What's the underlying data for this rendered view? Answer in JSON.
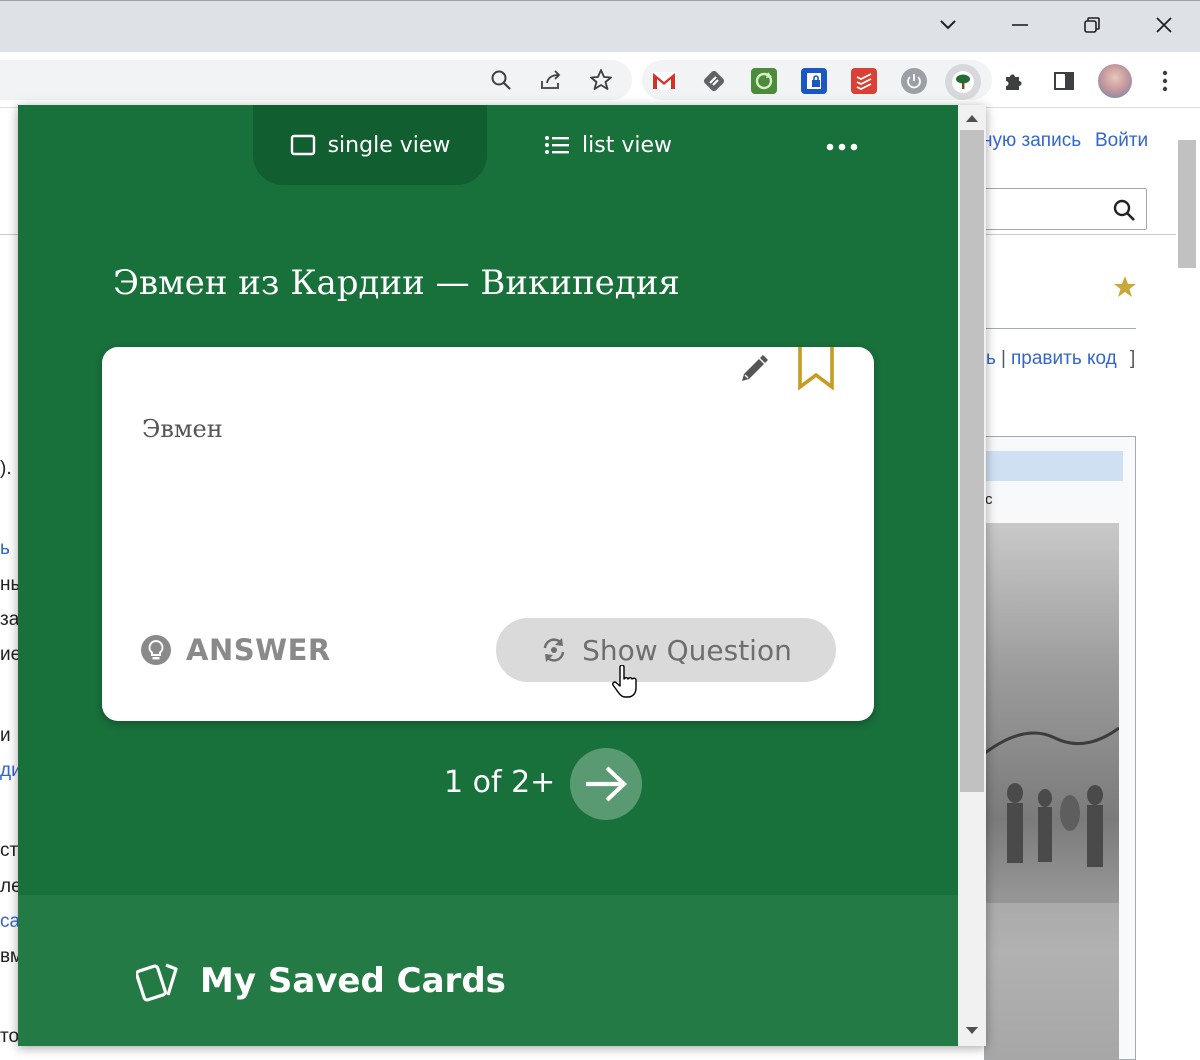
{
  "browser": {
    "window_controls": {
      "tab_search": "chevron-down-icon",
      "minimize": "minimize-icon",
      "restore": "restore-icon",
      "close": "close-icon"
    },
    "toolbar_icons": [
      "search-icon",
      "share-icon",
      "star-icon"
    ],
    "extensions": [
      "gmail-icon",
      "feedly-icon",
      "refresh-extension-icon",
      "lock-extension-icon",
      "todoist-icon",
      "power-icon",
      "tree-extension-icon",
      "puzzle-icon",
      "side-panel-icon",
      "profile-avatar",
      "kebab-menu-icon"
    ]
  },
  "wiki": {
    "create_account": "ную запись",
    "login": "Войти",
    "edit_links": {
      "edit_prefix": "ь",
      "separator": "|",
      "edit_code": "править код",
      "close_bracket": "]"
    },
    "left_fragments": [
      "). Г",
      "ь",
      "ны",
      "за",
      "ие",
      "и",
      "ди",
      "ст",
      "ле",
      "са",
      "вм",
      "то"
    ],
    "infobox_fragment": "с"
  },
  "popup": {
    "tabs": {
      "single_view": "single view",
      "list_view": "list view"
    },
    "title": "Эвмен из Кардии — Википедия",
    "card": {
      "text": "Эвмен",
      "answer_label": "ANSWER",
      "show_question": "Show Question"
    },
    "counter": "1 of 2+",
    "footer": {
      "saved_cards": "My Saved Cards"
    },
    "colors": {
      "main_bg": "#18703b",
      "active_tab_bg": "#115e30",
      "footer_bg": "#247a45",
      "bookmark": "#c89b22",
      "next_button": "#5a9a72"
    }
  }
}
